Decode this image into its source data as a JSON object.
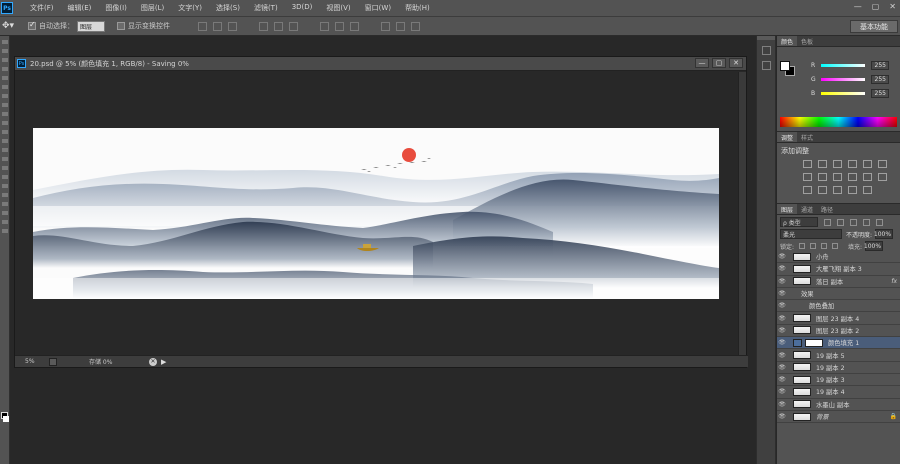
{
  "menu": {
    "logo": "Ps",
    "items": [
      "文件(F)",
      "编辑(E)",
      "图像(I)",
      "图层(L)",
      "文字(Y)",
      "选择(S)",
      "滤镜(T)",
      "3D(D)",
      "视图(V)",
      "窗口(W)",
      "帮助(H)"
    ],
    "window_controls": [
      "—",
      "▢",
      "✕"
    ]
  },
  "options": {
    "tool_icon": "move-tool-icon",
    "auto_select_label": "自动选择：",
    "auto_select_value": "图层",
    "transform_label": "显示变换控件",
    "workspace": "基本功能"
  },
  "document": {
    "icon": "Ps",
    "title": "20.psd @ 5% (颜色填充 1, RGB/8) - Saving 0%",
    "controls": [
      "—",
      "▢",
      "✕"
    ],
    "zoom": "5%",
    "save_status": "存储 0%",
    "status_arrow": "▶"
  },
  "colors": {
    "accent_red": "#e84c3d",
    "mountain_dark": "#3e4d66",
    "selected_layer": "#4a5d7a"
  },
  "color_panel": {
    "tabs": [
      "颜色",
      "色板"
    ],
    "channels": [
      {
        "label": "R",
        "value": "255",
        "gradient": "linear-gradient(to right,#00ffff,#ffffff)"
      },
      {
        "label": "G",
        "value": "255",
        "gradient": "linear-gradient(to right,#ff00ff,#ffffff)"
      },
      {
        "label": "B",
        "value": "255",
        "gradient": "linear-gradient(to right,#ffff00,#ffffff)"
      }
    ]
  },
  "adjust_panel": {
    "tabs": [
      "调整",
      "样式"
    ],
    "title": "添加调整"
  },
  "layers_panel": {
    "tabs": [
      "图层",
      "通道",
      "路径"
    ],
    "filter": "ρ 类型",
    "blend_mode": "柔光",
    "opacity_label": "不透明度:",
    "opacity": "100%",
    "lock_label": "锁定:",
    "fill_label": "填充:",
    "fill": "100%",
    "layers": [
      {
        "name": "小舟",
        "type": "normal"
      },
      {
        "name": "大雁飞翔 副本 3",
        "type": "normal"
      },
      {
        "name": "落日 副本",
        "type": "normal",
        "fx": "fx"
      },
      {
        "name": "效果",
        "type": "effects"
      },
      {
        "name": "颜色叠加",
        "type": "effect"
      },
      {
        "name": "图层 23 副本 4",
        "type": "normal"
      },
      {
        "name": "图层 23 副本 2",
        "type": "normal"
      },
      {
        "name": "颜色填充 1",
        "type": "fill",
        "selected": true
      },
      {
        "name": "19 副本 5",
        "type": "normal"
      },
      {
        "name": "19 副本 2",
        "type": "normal"
      },
      {
        "name": "19 副本 3",
        "type": "normal"
      },
      {
        "name": "19 副本 4",
        "type": "normal"
      },
      {
        "name": "水墨山 副本",
        "type": "normal"
      },
      {
        "name": "背景",
        "type": "background",
        "locked": true
      }
    ]
  }
}
